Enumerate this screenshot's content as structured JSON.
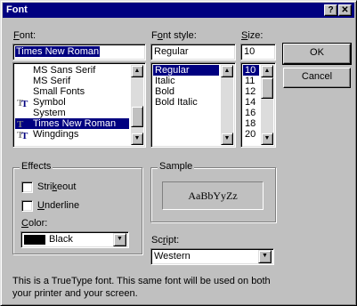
{
  "dialog": {
    "title": "Font",
    "help_glyph": "?",
    "close_glyph": "✕"
  },
  "font": {
    "label_pre": "",
    "label_key": "F",
    "label_post": "ont:",
    "value": "Times New Roman",
    "items": [
      {
        "name": "MS Sans Serif",
        "icon": "none"
      },
      {
        "name": "MS Serif",
        "icon": "none"
      },
      {
        "name": "Small Fonts",
        "icon": "none"
      },
      {
        "name": "Symbol",
        "icon": "truetype-icon"
      },
      {
        "name": "System",
        "icon": "none"
      },
      {
        "name": "Times New Roman",
        "icon": "truetype-icon"
      },
      {
        "name": "Wingdings",
        "icon": "truetype-icon"
      }
    ],
    "selected_index": 5
  },
  "style": {
    "label_pre": "F",
    "label_key": "o",
    "label_post": "nt style:",
    "value": "Regular",
    "items": [
      "Regular",
      "Italic",
      "Bold",
      "Bold Italic"
    ],
    "selected_index": 0
  },
  "size": {
    "label_key": "S",
    "label_post": "ize:",
    "value": "10",
    "items": [
      "10",
      "11",
      "12",
      "14",
      "16",
      "18",
      "20"
    ],
    "selected_index": 0
  },
  "buttons": {
    "ok": "OK",
    "cancel": "Cancel"
  },
  "effects": {
    "title": "Effects",
    "strikeout_pre": "Stri",
    "strikeout_key": "k",
    "strikeout_post": "eout",
    "underline_key": "U",
    "underline_post": "nderline",
    "strikeout_checked": false,
    "underline_checked": false,
    "color_key": "C",
    "color_post": "olor:",
    "color_value": "Black",
    "color_swatch": "#000000"
  },
  "sample": {
    "title": "Sample",
    "text": "AaBbYyZz"
  },
  "script": {
    "label_pre": "Sc",
    "label_key": "r",
    "label_post": "ipt:",
    "value": "Western"
  },
  "description": {
    "line1": "This is a TrueType font. This same font will be used on both",
    "line2": "your printer and your screen."
  },
  "colors": {
    "title_bar": "#000080",
    "face": "#c0c0c0",
    "selection": "#000080"
  }
}
